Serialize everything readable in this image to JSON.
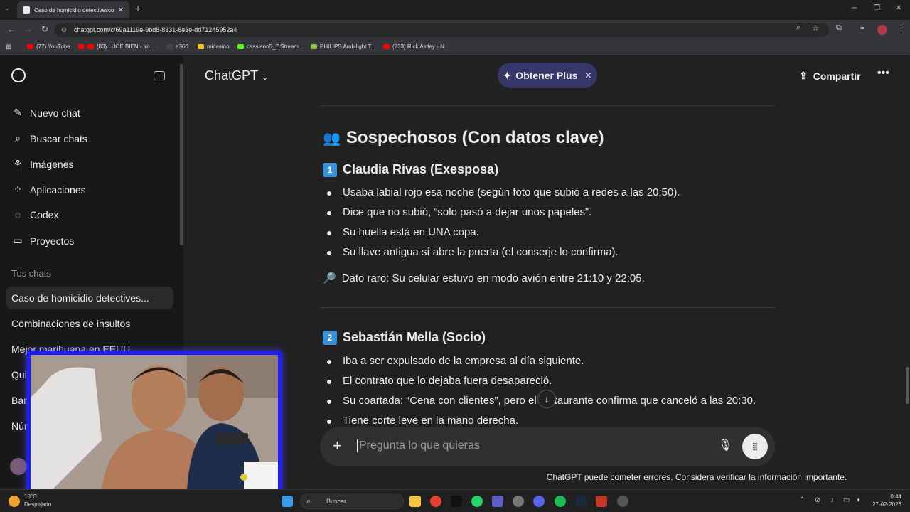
{
  "browser": {
    "tab_title": "Caso de homicidio detectivesco",
    "url": "chatgpt.com/c/69a1119e-9bd8-8331-8e3e-dd71245952a4",
    "bookmarks": [
      {
        "label": "(77) YouTube",
        "color": "#ff0000"
      },
      {
        "label": "(83) LUCE BIEN - Yo...",
        "color": "#ff0000"
      },
      {
        "label": "a360",
        "color": "#444444"
      },
      {
        "label": "micasino",
        "color": "#f5c518"
      },
      {
        "label": "cassiano5_7 Stream...",
        "color": "#53fc18"
      },
      {
        "label": "PHILIPS Ambilight T...",
        "color": "#8bc34a"
      },
      {
        "label": "(233) Rick Astley - N...",
        "color": "#ff0000"
      }
    ]
  },
  "sidebar": {
    "nav": [
      {
        "label": "Nuevo chat",
        "icon": "edit-icon"
      },
      {
        "label": "Buscar chats",
        "icon": "search-icon"
      },
      {
        "label": "Imágenes",
        "icon": "images-icon"
      },
      {
        "label": "Aplicaciones",
        "icon": "apps-icon"
      },
      {
        "label": "Codex",
        "icon": "codex-icon"
      },
      {
        "label": "Proyectos",
        "icon": "folder-icon"
      }
    ],
    "section_title": "Tus chats",
    "chats": [
      "Caso de homicidio detectives...",
      "Combinaciones de insultos",
      "Mejor marihuana en EEUU",
      "Quit",
      "Banc",
      "Nún"
    ]
  },
  "header": {
    "model": "ChatGPT",
    "plus_label": "Obtener Plus",
    "share_label": "Compartir"
  },
  "content": {
    "section_title": "Sospechosos (Con datos clave)",
    "suspect1": {
      "number": "1",
      "name": "Claudia Rivas (Exesposa)",
      "bullets": [
        "Usaba labial rojo esa noche (según foto que subió a redes a las 20:50).",
        "Dice que no subió, “solo pasó a dejar unos papeles”.",
        "Su huella está en UNA copa.",
        "Su llave antigua sí abre la puerta (el conserje lo confirma)."
      ],
      "dato": "Dato raro: Su celular estuvo en modo avión entre 21:10 y 22:05."
    },
    "suspect2": {
      "number": "2",
      "name": "Sebastián Mella (Socio)",
      "bullets": [
        "Iba a ser expulsado de la empresa al día siguiente.",
        "El contrato que lo dejaba fuera desapareció.",
        "Su coartada: “Cena con clientes”, pero el restaurante confirma que canceló a las 20:30.",
        "Tiene corte leve en la mano derecha."
      ]
    }
  },
  "composer": {
    "placeholder": "Pregunta lo que quieras"
  },
  "disclaimer": "ChatGPT puede cometer errores. Considera verificar la información importante.",
  "taskbar": {
    "weather_temp": "18°C",
    "weather_desc": "Despejado",
    "search_label": "Buscar",
    "time": "0:44",
    "date": "27-02-2026"
  }
}
